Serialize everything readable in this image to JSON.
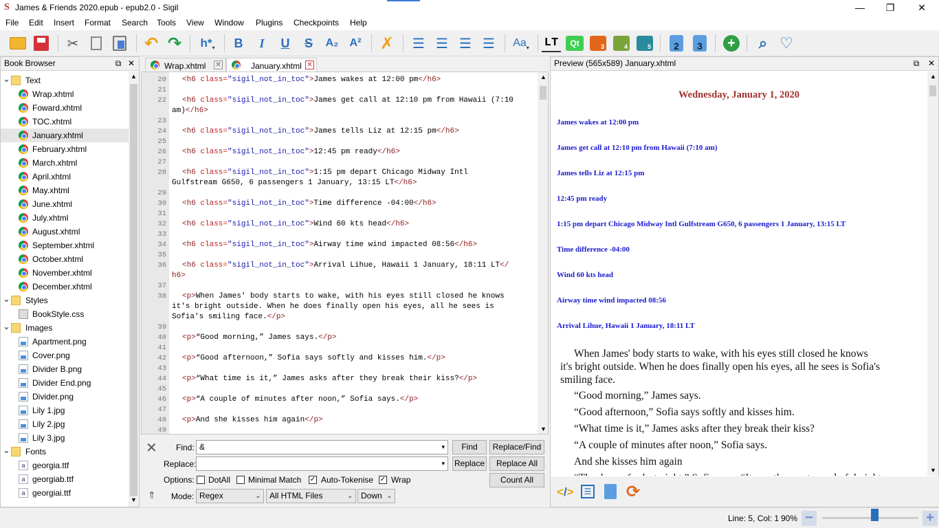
{
  "window": {
    "title": "James & Friends 2020.epub - epub2.0 - Sigil",
    "min": "—",
    "max": "❐",
    "close": "✕"
  },
  "menu": [
    "File",
    "Edit",
    "Insert",
    "Format",
    "Search",
    "Tools",
    "View",
    "Window",
    "Plugins",
    "Checkpoints",
    "Help"
  ],
  "toolbar": {
    "heading_label": "h*",
    "bold": "B",
    "italic": "I",
    "underline": "U",
    "strike": "S",
    "subscript": "A₂",
    "superscript": "A²",
    "case": "Aa",
    "lt": "LT",
    "qt": "Qt",
    "plugin_badges": [
      "3",
      "4",
      "5"
    ],
    "toc_badges": [
      "2",
      "3"
    ]
  },
  "book_browser": {
    "title": "Book Browser",
    "items": [
      {
        "type": "folder",
        "label": "Text",
        "open": true
      },
      {
        "type": "html",
        "label": "Wrap.xhtml"
      },
      {
        "type": "html",
        "label": "Foward.xhtml"
      },
      {
        "type": "html",
        "label": "TOC.xhtml"
      },
      {
        "type": "html",
        "label": "January.xhtml",
        "selected": true
      },
      {
        "type": "html",
        "label": "February.xhtml"
      },
      {
        "type": "html",
        "label": "March.xhtml"
      },
      {
        "type": "html",
        "label": "April.xhtml"
      },
      {
        "type": "html",
        "label": "May.xhtml"
      },
      {
        "type": "html",
        "label": "June.xhtml"
      },
      {
        "type": "html",
        "label": "July.xhtml"
      },
      {
        "type": "html",
        "label": "August.xhtml"
      },
      {
        "type": "html",
        "label": "September.xhtml"
      },
      {
        "type": "html",
        "label": "October.xhtml"
      },
      {
        "type": "html",
        "label": "November.xhtml"
      },
      {
        "type": "html",
        "label": "December.xhtml"
      },
      {
        "type": "folder",
        "label": "Styles",
        "open": true
      },
      {
        "type": "css",
        "label": "BookStyle.css"
      },
      {
        "type": "folder",
        "label": "Images",
        "open": true
      },
      {
        "type": "image",
        "label": "Apartment.png"
      },
      {
        "type": "image",
        "label": "Cover.png"
      },
      {
        "type": "image",
        "label": "Divider B.png"
      },
      {
        "type": "image",
        "label": "Divider End.png"
      },
      {
        "type": "image",
        "label": "Divider.png"
      },
      {
        "type": "image",
        "label": "Lily 1.jpg"
      },
      {
        "type": "image",
        "label": "Lily 2.jpg"
      },
      {
        "type": "image",
        "label": "Lily 3.jpg"
      },
      {
        "type": "folder",
        "label": "Fonts",
        "open": true
      },
      {
        "type": "font",
        "label": "georgia.ttf"
      },
      {
        "type": "font",
        "label": "georgiab.ttf"
      },
      {
        "type": "font",
        "label": "georgiai.ttf"
      }
    ]
  },
  "tabs": [
    {
      "label": "Wrap.xhtml",
      "active": false
    },
    {
      "label": "January.xhtml",
      "active": true
    }
  ],
  "code_lines": [
    {
      "n": "20",
      "parts": [
        [
          "tg",
          "<h6 "
        ],
        [
          "at",
          "class="
        ],
        [
          "av",
          "\"sigil_not_in_toc\""
        ],
        [
          "tg",
          ">"
        ],
        [
          "tx",
          "James wakes at 12:00 pm"
        ],
        [
          "tg",
          "</h6>"
        ]
      ]
    },
    {
      "n": "21",
      "parts": []
    },
    {
      "n": "22",
      "parts": [
        [
          "tg",
          "<h6 "
        ],
        [
          "at",
          "class="
        ],
        [
          "av",
          "\"sigil_not_in_toc\""
        ],
        [
          "tg",
          ">"
        ],
        [
          "tx",
          "James get call at 12:10 pm from Hawaii (7:10"
        ]
      ]
    },
    {
      "n": "",
      "parts": [
        [
          "tx",
          "am)"
        ],
        [
          "tg",
          "</h6>"
        ]
      ]
    },
    {
      "n": "23",
      "parts": []
    },
    {
      "n": "24",
      "parts": [
        [
          "tg",
          "<h6 "
        ],
        [
          "at",
          "class="
        ],
        [
          "av",
          "\"sigil_not_in_toc\""
        ],
        [
          "tg",
          ">"
        ],
        [
          "tx",
          "James tells Liz at 12:15 pm"
        ],
        [
          "tg",
          "</h6>"
        ]
      ]
    },
    {
      "n": "25",
      "parts": []
    },
    {
      "n": "26",
      "parts": [
        [
          "tg",
          "<h6 "
        ],
        [
          "at",
          "class="
        ],
        [
          "av",
          "\"sigil_not_in_toc\""
        ],
        [
          "tg",
          ">"
        ],
        [
          "tx",
          "12:45 pm ready"
        ],
        [
          "tg",
          "</h6>"
        ]
      ]
    },
    {
      "n": "27",
      "parts": []
    },
    {
      "n": "28",
      "parts": [
        [
          "tg",
          "<h6 "
        ],
        [
          "at",
          "class="
        ],
        [
          "av",
          "\"sigil_not_in_toc\""
        ],
        [
          "tg",
          ">"
        ],
        [
          "tx",
          "1:15 pm depart Chicago Midway Intl"
        ]
      ]
    },
    {
      "n": "",
      "parts": [
        [
          "tx",
          "Gulfstream G650, 6 passengers 1 January, 13:15 LT"
        ],
        [
          "tg",
          "</h6>"
        ]
      ]
    },
    {
      "n": "29",
      "parts": []
    },
    {
      "n": "30",
      "parts": [
        [
          "tg",
          "<h6 "
        ],
        [
          "at",
          "class="
        ],
        [
          "av",
          "\"sigil_not_in_toc\""
        ],
        [
          "tg",
          ">"
        ],
        [
          "tx",
          "Time difference -04:00"
        ],
        [
          "tg",
          "</h6>"
        ]
      ]
    },
    {
      "n": "31",
      "parts": []
    },
    {
      "n": "32",
      "parts": [
        [
          "tg",
          "<h6 "
        ],
        [
          "at",
          "class="
        ],
        [
          "av",
          "\"sigil_not_in_toc\""
        ],
        [
          "tg",
          ">"
        ],
        [
          "tx",
          "Wind 60 kts head"
        ],
        [
          "tg",
          "</h6>"
        ]
      ]
    },
    {
      "n": "33",
      "parts": []
    },
    {
      "n": "34",
      "parts": [
        [
          "tg",
          "<h6 "
        ],
        [
          "at",
          "class="
        ],
        [
          "av",
          "\"sigil_not_in_toc\""
        ],
        [
          "tg",
          ">"
        ],
        [
          "tx",
          "Airway time wind impacted 08:56"
        ],
        [
          "tg",
          "</h6>"
        ]
      ]
    },
    {
      "n": "35",
      "parts": []
    },
    {
      "n": "36",
      "parts": [
        [
          "tg",
          "<h6 "
        ],
        [
          "at",
          "class="
        ],
        [
          "av",
          "\"sigil_not_in_toc\""
        ],
        [
          "tg",
          ">"
        ],
        [
          "tx",
          "Arrival Lihue, Hawaii 1 January, 18:11 LT"
        ],
        [
          "tg",
          "</"
        ]
      ]
    },
    {
      "n": "",
      "parts": [
        [
          "tg",
          "h6>"
        ]
      ]
    },
    {
      "n": "37",
      "parts": []
    },
    {
      "n": "38",
      "parts": [
        [
          "tg",
          "<p>"
        ],
        [
          "tx",
          "When James' body starts to wake, with his eyes still closed he knows"
        ]
      ]
    },
    {
      "n": "",
      "parts": [
        [
          "tx",
          "it's bright outside. When he does finally open his eyes, all he sees is"
        ]
      ]
    },
    {
      "n": "",
      "parts": [
        [
          "tx",
          "Sofia's smiling face."
        ],
        [
          "tg",
          "</p>"
        ]
      ]
    },
    {
      "n": "39",
      "parts": []
    },
    {
      "n": "40",
      "parts": [
        [
          "tg",
          "<p>"
        ],
        [
          "tx",
          "“Good morning,” James says."
        ],
        [
          "tg",
          "</p>"
        ]
      ]
    },
    {
      "n": "41",
      "parts": []
    },
    {
      "n": "42",
      "parts": [
        [
          "tg",
          "<p>"
        ],
        [
          "tx",
          "“Good afternoon,” Sofia says softly and kisses him."
        ],
        [
          "tg",
          "</p>"
        ]
      ]
    },
    {
      "n": "43",
      "parts": []
    },
    {
      "n": "44",
      "parts": [
        [
          "tg",
          "<p>"
        ],
        [
          "tx",
          "“What time is it,” James asks after they break their kiss?"
        ],
        [
          "tg",
          "</p>"
        ]
      ]
    },
    {
      "n": "45",
      "parts": []
    },
    {
      "n": "46",
      "parts": [
        [
          "tg",
          "<p>"
        ],
        [
          "tx",
          "“A couple of minutes after noon,” Sofia says."
        ],
        [
          "tg",
          "</p>"
        ]
      ]
    },
    {
      "n": "47",
      "parts": []
    },
    {
      "n": "48",
      "parts": [
        [
          "tg",
          "<p>"
        ],
        [
          "tx",
          "And she kisses him again"
        ],
        [
          "tg",
          "</p>"
        ]
      ]
    },
    {
      "n": "49",
      "parts": []
    }
  ],
  "find": {
    "find_label": "Find:",
    "find_value": "&",
    "replace_label": "Replace:",
    "replace_value": "",
    "options_label": "Options:",
    "dotall": "DotAll",
    "minimal": "Minimal Match",
    "autotok": "Auto-Tokenise",
    "wrap": "Wrap",
    "mode_label": "Mode:",
    "mode": "Regex",
    "scope": "All HTML Files",
    "direction": "Down",
    "btn_find": "Find",
    "btn_replace_find": "Replace/Find",
    "btn_replace": "Replace",
    "btn_replace_all": "Replace All",
    "btn_count_all": "Count All"
  },
  "preview": {
    "title": "Preview (565x589) January.xhtml",
    "heading": "Wednesday, January 1, 2020",
    "h6": [
      "James wakes at 12:00 pm",
      "James get call at 12:10 pm from Hawaii (7:10 am)",
      "James tells Liz at 12:15 pm",
      "12:45 pm ready",
      "1:15 pm depart Chicago Midway Intl Gulfstream G650, 6 passengers 1 January, 13:15 LT",
      "Time difference -04:00",
      "Wind 60 kts head",
      "Airway time wind impacted 08:56",
      "Arrival Lihue, Hawaii 1 January, 18:11 LT"
    ],
    "para1_l1": "When James' body starts to wake, with his eyes still closed he knows",
    "para1_l2": "it's bright outside. When he does finally open his eyes, all he sees is Sofia's",
    "para1_l3": "smiling face.",
    "paras": [
      "“Good morning,” James says.",
      "“Good afternoon,” Sofia says softly and kisses him.",
      "“What time is it,” James asks after they break their kiss?",
      "“A couple of minutes after noon,” Sofia says.",
      "And she kisses him again",
      "“Thank you for last night,” Sofia says. “It was the most wonderful night"
    ]
  },
  "status": {
    "position": "Line: 5, Col: 1",
    "zoom": "90%",
    "zoom_level": 0.55
  },
  "colors": {
    "tag": "#8b1a1a",
    "attr": "#c02020",
    "value": "#1a1aa6",
    "h6": "#1a1ad0",
    "heading": "#a0322d"
  }
}
